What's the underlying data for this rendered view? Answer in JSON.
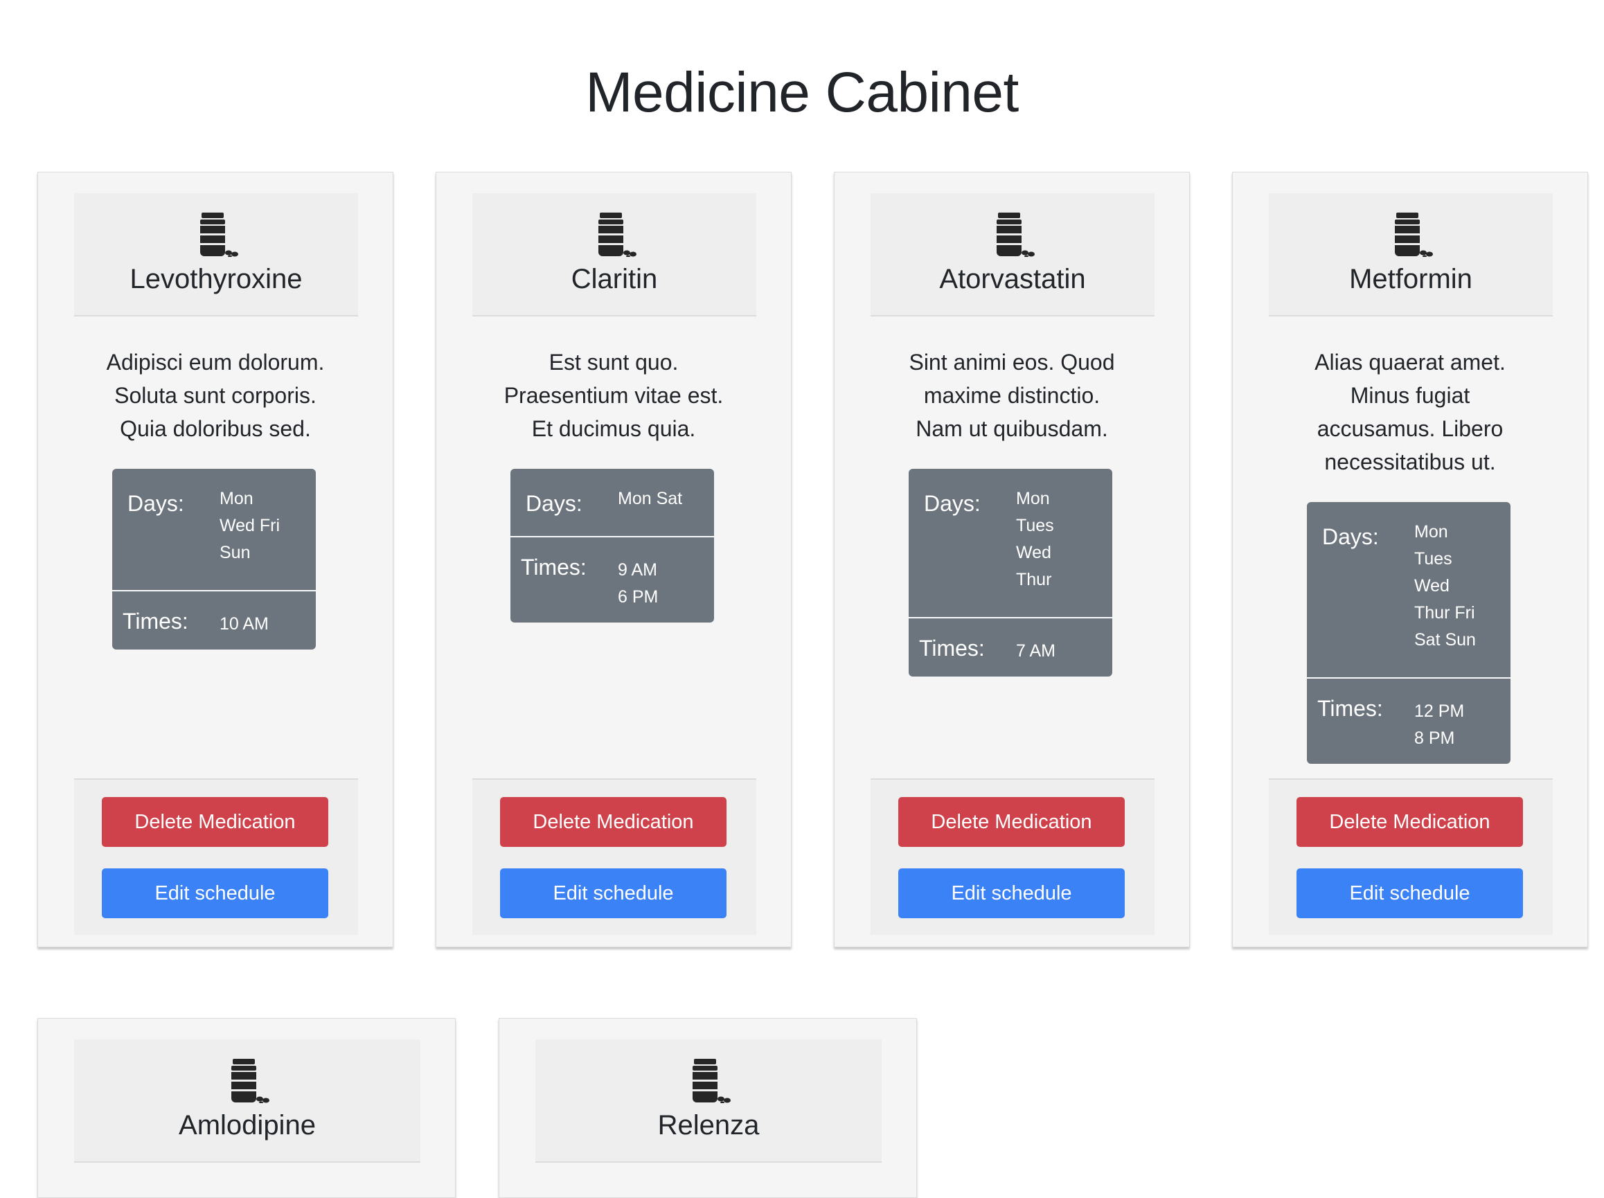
{
  "page": {
    "title": "Medicine Cabinet"
  },
  "icon": "pill-bottle-icon",
  "labels": {
    "days": "Days:",
    "times": "Times:",
    "delete": "Delete Medication",
    "edit": "Edit schedule"
  },
  "colors": {
    "delete_button": "#d0424b",
    "edit_button": "#3b82f6",
    "schedule_panel": "#6c757d"
  },
  "medications": [
    {
      "name": "Levothyroxine",
      "description": [
        "Adipisci eum dolorum.",
        "Soluta sunt corporis.",
        "Quia doloribus sed."
      ],
      "days": [
        "Mon",
        "Wed Fri",
        "Sun"
      ],
      "times": [
        "10 AM"
      ]
    },
    {
      "name": "Claritin",
      "description": [
        "Est sunt quo.",
        "Praesentium vitae est.",
        "Et ducimus quia."
      ],
      "days": [
        "Mon Sat"
      ],
      "times": [
        "9 AM",
        "6 PM"
      ]
    },
    {
      "name": "Atorvastatin",
      "description": [
        "Sint animi eos. Quod",
        "maxime distinctio.",
        "Nam ut quibusdam."
      ],
      "days": [
        "Mon",
        "Tues",
        "Wed",
        "Thur"
      ],
      "times": [
        "7 AM"
      ]
    },
    {
      "name": "Metformin",
      "description": [
        "Alias quaerat amet.",
        "Minus fugiat",
        "accusamus. Libero",
        "necessitatibus ut."
      ],
      "days": [
        "Mon",
        "Tues",
        "Wed",
        "Thur Fri",
        "Sat Sun"
      ],
      "times": [
        "12 PM",
        "8 PM"
      ]
    },
    {
      "name": "Amlodipine"
    },
    {
      "name": "Relenza"
    }
  ]
}
